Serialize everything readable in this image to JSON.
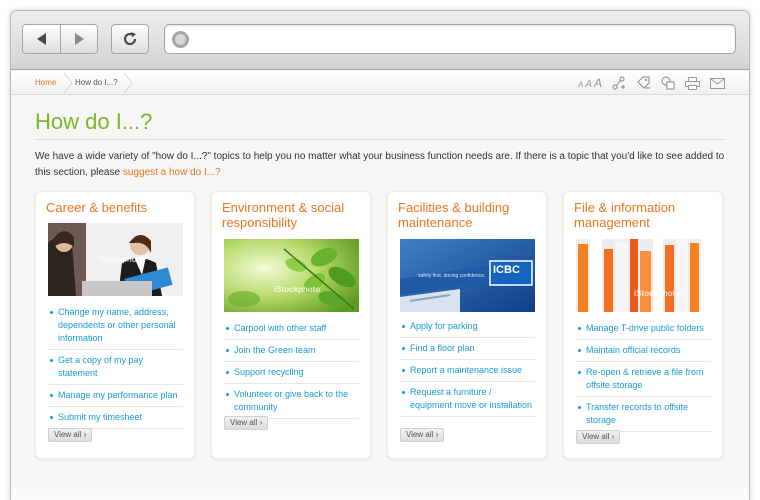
{
  "browser": {
    "back_icon": "arrow-left-icon",
    "forward_icon": "arrow-right-icon",
    "reload_icon": "reload-icon",
    "url": ""
  },
  "breadcrumb": {
    "home": "Home",
    "current": "How do I...?"
  },
  "tools": {
    "font_small": "A",
    "font_medium": "A",
    "font_large": "A"
  },
  "page": {
    "title": "How do I...?",
    "intro_text": "We have a wide variety of \"how do I...?\" topics to help you no matter what your business function needs are. If there is a topic that you'd like to see added to this section, please ",
    "intro_link": "suggest a how do I...?"
  },
  "cards": [
    {
      "title": "Career & benefits",
      "watermark": "iStockphoto",
      "links": [
        "Change my name, address, dependents or other personal information",
        "Get a copy of my pay statement",
        "Manage my performance plan",
        "Submit my timesheet"
      ],
      "view_all": "View all ›"
    },
    {
      "title": "Environment & social responsibility",
      "watermark": "iStockphoto",
      "links": [
        "Carpool with other staff",
        "Join the Green team",
        "Support recycling",
        "Volunteer or give back to the community"
      ],
      "view_all": "View all ›"
    },
    {
      "title": "Facilities & building maintenance",
      "image_text": "ICBC",
      "image_slogan": "safety first. driving confidence.",
      "links": [
        "Apply for parking",
        "Find a floor plan",
        "Report a maintenance issue",
        "Request a furniture / equipment move or installation"
      ],
      "view_all": "View all ›"
    },
    {
      "title": "File & information management",
      "watermark": "iStockphoto",
      "links": [
        "Manage T-drive public folders",
        "Maintain official records",
        "Re-open & retrieve a file from offsite storage",
        "Transfer records to offsite storage"
      ],
      "view_all": "View all ›"
    }
  ]
}
